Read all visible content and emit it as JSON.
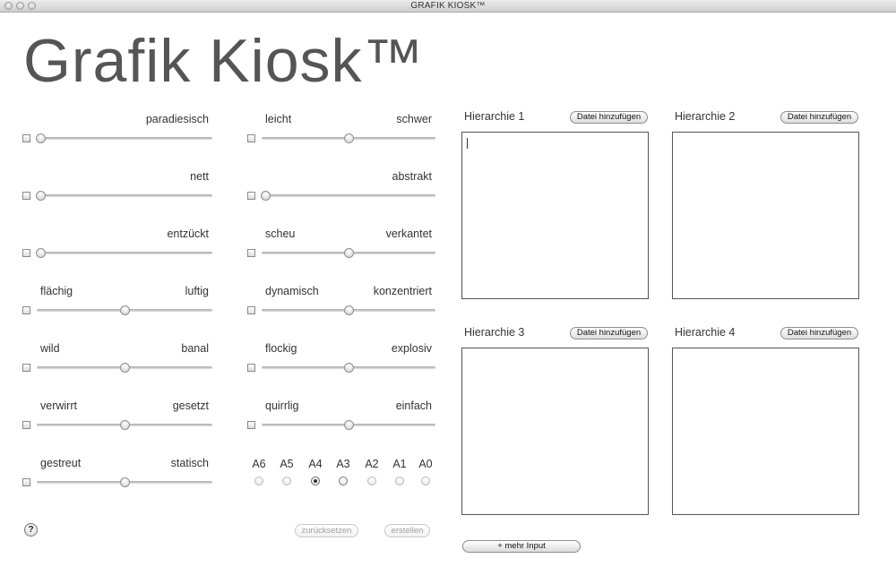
{
  "window": {
    "title": "GRAFIK KIOSK™"
  },
  "app": {
    "title": "Grafik Kiosk™"
  },
  "sliders_left": [
    {
      "left": "",
      "right": "paradiesisch",
      "value": 0.0
    },
    {
      "left": "",
      "right": "nett",
      "value": 0.0
    },
    {
      "left": "",
      "right": "entzückt",
      "value": 0.0
    },
    {
      "left": "flächig",
      "right": "luftig",
      "value": 0.5
    },
    {
      "left": "wild",
      "right": "banal",
      "value": 0.5
    },
    {
      "left": "verwirrt",
      "right": "gesetzt",
      "value": 0.5
    },
    {
      "left": "gestreut",
      "right": "statisch",
      "value": 0.5
    }
  ],
  "sliders_right": [
    {
      "left": "leicht",
      "right": "schwer",
      "value": 0.5
    },
    {
      "left": "",
      "right": "abstrakt",
      "value": 0.0
    },
    {
      "left": "scheu",
      "right": "verkantet",
      "value": 0.5
    },
    {
      "left": "dynamisch",
      "right": "konzentriert",
      "value": 0.5
    },
    {
      "left": "flockig",
      "right": "explosiv",
      "value": 0.5
    },
    {
      "left": "quirrlig",
      "right": "einfach",
      "value": 0.5
    }
  ],
  "formats": {
    "options": [
      "A6",
      "A5",
      "A4",
      "A3",
      "A2",
      "A1",
      "A0"
    ],
    "selected": "A4"
  },
  "buttons": {
    "help": "?",
    "reset": "zurücksetzen",
    "create": "erstellen",
    "more_input": "+ mehr Input"
  },
  "hierarchies": [
    {
      "label": "Hierarchie 1",
      "add_label": "Datei hinzufügen"
    },
    {
      "label": "Hierarchie 2",
      "add_label": "Datei hinzufügen"
    },
    {
      "label": "Hierarchie 3",
      "add_label": "Datei hinzufügen"
    },
    {
      "label": "Hierarchie 4",
      "add_label": "Datei hinzufügen"
    }
  ]
}
